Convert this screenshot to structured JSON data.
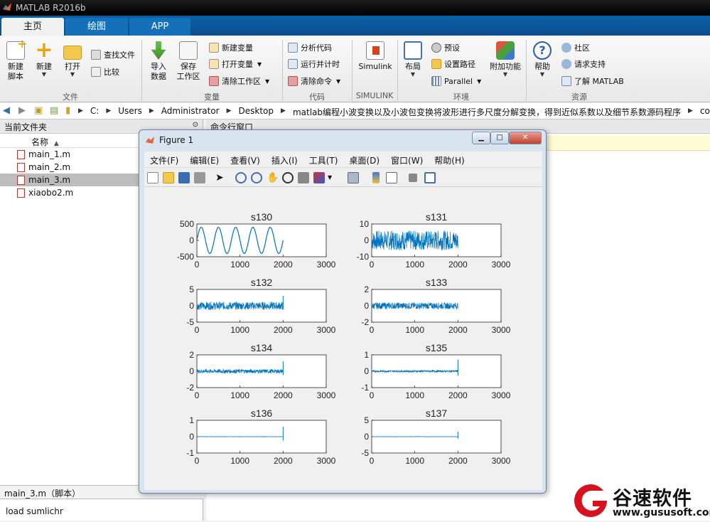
{
  "window": {
    "title": "MATLAB R2016b"
  },
  "tabs": [
    "主页",
    "绘图",
    "APP"
  ],
  "ribbon": {
    "file": {
      "new_script": [
        "新建",
        "脚本"
      ],
      "new": "新建",
      "open": "打开",
      "find_files": "查找文件",
      "compare": "比较",
      "group": "文件"
    },
    "variable": {
      "import": [
        "导入",
        "数据"
      ],
      "save": [
        "保存",
        "工作区"
      ],
      "new_var": "新建变量",
      "open_var": "打开变量",
      "clear_ws": "清除工作区",
      "group": "变量"
    },
    "code": {
      "analyze": "分析代码",
      "run_time": "运行并计时",
      "clear_cmd": "清除命令",
      "group": "代码"
    },
    "simulink": {
      "label": "Simulink",
      "group": "SIMULINK"
    },
    "env": {
      "layout": "布局",
      "prefs": "预设",
      "set_path": "设置路径",
      "parallel": "Parallel",
      "addons": "附加功能",
      "group": "环境"
    },
    "resources": {
      "help": "帮助",
      "community": "社区",
      "support": "请求支持",
      "learn": "了解 MATLAB",
      "group": "资源"
    }
  },
  "address": {
    "crumbs": [
      "C:",
      "Users",
      "Administrator",
      "Desktop",
      "matlab编程小波变换以及小波包变换将波形进行多尺度分解变换，得到近似系数以及细节系数源码程序",
      "code"
    ]
  },
  "folder": {
    "title": "当前文件夹",
    "col": "名称",
    "files": [
      "main_1.m",
      "main_2.m",
      "main_3.m",
      "xiaobo2.m"
    ],
    "selected": "main_3.m",
    "details": "main_3.m（脚本）",
    "code_line": "load sumlichr"
  },
  "cmd": {
    "title": "命令行窗口"
  },
  "figure": {
    "title": "Figure 1",
    "menus": [
      "文件(F)",
      "编辑(E)",
      "查看(V)",
      "插入(I)",
      "工具(T)",
      "桌面(D)",
      "窗口(W)",
      "帮助(H)"
    ]
  },
  "colors": {
    "signal": "#0072bd",
    "tab_bar": "#0b5fa7",
    "logo_red": "#d6121e"
  },
  "chart_data": [
    {
      "type": "line",
      "title": "s130",
      "xlim": [
        0,
        3000
      ],
      "ylim": [
        -500,
        500
      ],
      "xticks": [
        0,
        1000,
        2000,
        3000
      ],
      "yticks": [
        500,
        0,
        -500
      ],
      "kind": "sine",
      "amplitude": 400,
      "cycles": 5,
      "x_end": 2000
    },
    {
      "type": "line",
      "title": "s131",
      "xlim": [
        0,
        3000
      ],
      "ylim": [
        -10,
        10
      ],
      "xticks": [
        0,
        1000,
        2000,
        3000
      ],
      "yticks": [
        10,
        0,
        -10
      ],
      "kind": "noise",
      "amplitude": 6,
      "x_end": 2000
    },
    {
      "type": "line",
      "title": "s132",
      "xlim": [
        0,
        3000
      ],
      "ylim": [
        -5,
        5
      ],
      "xticks": [
        0,
        1000,
        2000,
        3000
      ],
      "yticks": [
        5,
        0,
        -5
      ],
      "kind": "noise",
      "amplitude": 1.2,
      "spike": 3,
      "x_end": 2000
    },
    {
      "type": "line",
      "title": "s133",
      "xlim": [
        0,
        3000
      ],
      "ylim": [
        -2,
        2
      ],
      "xticks": [
        0,
        1000,
        2000,
        3000
      ],
      "yticks": [
        2,
        0,
        -2
      ],
      "kind": "noise",
      "amplitude": 0.4,
      "x_end": 2000
    },
    {
      "type": "line",
      "title": "s134",
      "xlim": [
        0,
        3000
      ],
      "ylim": [
        -2,
        2
      ],
      "xticks": [
        0,
        1000,
        2000,
        3000
      ],
      "yticks": [
        2,
        0,
        -2
      ],
      "kind": "noise",
      "amplitude": 0.25,
      "spike": 1.2,
      "x_end": 2000
    },
    {
      "type": "line",
      "title": "s135",
      "xlim": [
        0,
        3000
      ],
      "ylim": [
        -1,
        1
      ],
      "xticks": [
        0,
        1000,
        2000,
        3000
      ],
      "yticks": [
        1,
        0,
        -1
      ],
      "kind": "noise",
      "amplitude": 0.06,
      "spike": 0.7,
      "x_end": 2000
    },
    {
      "type": "line",
      "title": "s136",
      "xlim": [
        0,
        3000
      ],
      "ylim": [
        -1,
        1
      ],
      "xticks": [
        0,
        1000,
        2000,
        3000
      ],
      "yticks": [
        1,
        0,
        -1
      ],
      "kind": "noise",
      "amplitude": 0.01,
      "spike": 0.6,
      "x_end": 2000
    },
    {
      "type": "line",
      "title": "s137",
      "xlim": [
        0,
        3000
      ],
      "ylim": [
        -5,
        5
      ],
      "xticks": [
        0,
        1000,
        2000,
        3000
      ],
      "yticks": [
        5,
        0,
        -5
      ],
      "kind": "noise",
      "amplitude": 0.05,
      "spike": 1.5,
      "x_end": 2000
    }
  ],
  "watermark": {
    "brand": "谷速软件",
    "url": "www.gususoft.com"
  }
}
